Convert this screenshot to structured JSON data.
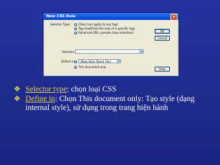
{
  "dialog": {
    "title": "New CSS Rule",
    "selector_type_label": "Selector Type:",
    "selector_options": [
      "Class (can apply to any tag)",
      "Tag (redefines the look of a specific tag)",
      "Advanced (IDs, pseudo-class selectors)"
    ],
    "selector_selected_index": 2,
    "selector_label": "Selector:",
    "selector_value": "",
    "define_in_label": "Define in:",
    "define_in_options": [
      "(New Style Sheet File)",
      "This document only"
    ],
    "define_in_selected_index": 1,
    "buttons": {
      "ok": "OK",
      "cancel": "Cancel",
      "help": "Help"
    }
  },
  "bullets": [
    {
      "key": "Selector type",
      "text": ": chọn loại CSS"
    },
    {
      "key": "Define in",
      "text": ": Chọn This document only: Tạo style (dạng internal style), sử dụng trong trang hiện hành"
    }
  ],
  "colors": {
    "slide_background": "#1e2b8c",
    "keyword": "#e2cf50",
    "body_text": "#ffffff",
    "titlebar": "#0a56e6"
  }
}
